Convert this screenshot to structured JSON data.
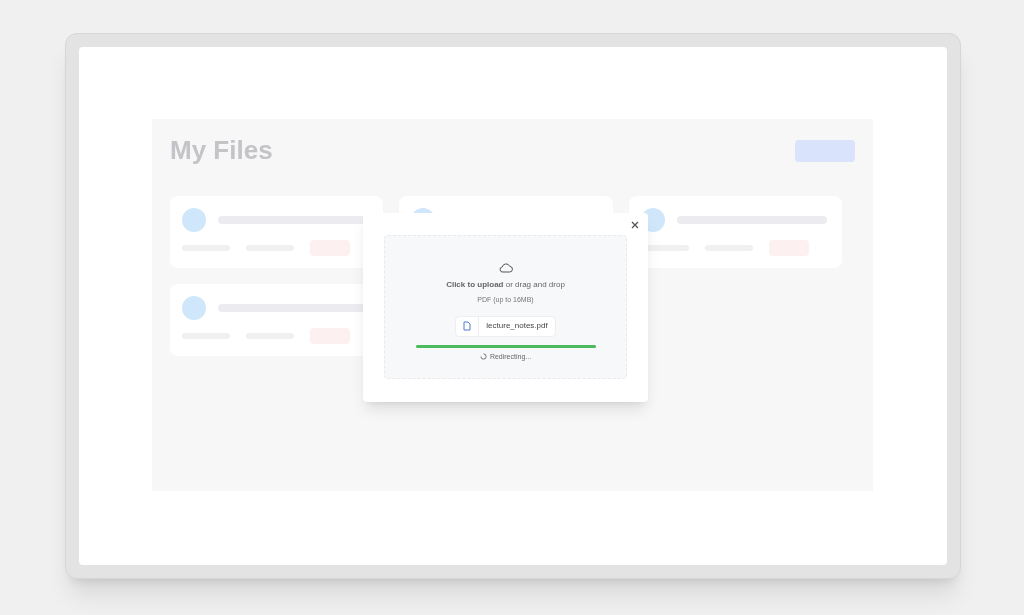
{
  "page": {
    "title": "My Files"
  },
  "files": [
    {
      "kind": "card"
    },
    {
      "kind": "covered"
    },
    {
      "kind": "card"
    },
    {
      "kind": "card"
    }
  ],
  "upload_dialog": {
    "prompt": "**Click to upload** or drag and drop",
    "hint": "PDF (up to 16MB)",
    "file_name": "lecture_notes.pdf",
    "level": 1,
    "status": "Redirecting..."
  }
}
